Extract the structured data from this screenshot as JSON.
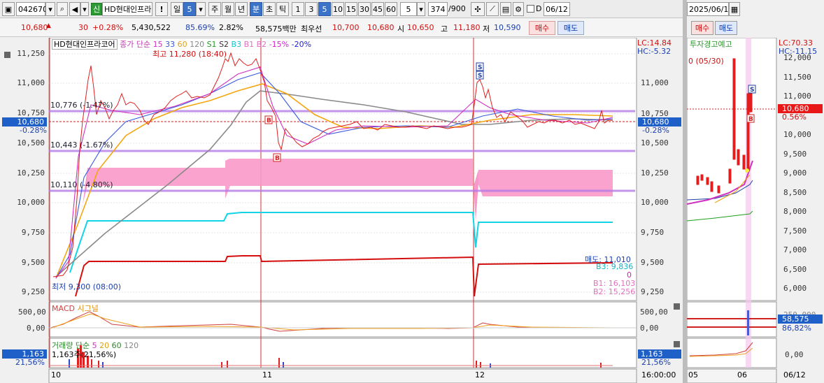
{
  "toolbar": {
    "code": "042670",
    "credit_badge": "신",
    "stock_name": "HD현대인프라",
    "warn": "!",
    "period_label": "일",
    "period_value": "5",
    "periods": [
      "주",
      "월",
      "년",
      "분",
      "초",
      "틱"
    ],
    "intervals": [
      "1",
      "3",
      "5",
      "10",
      "15",
      "30",
      "45",
      "60"
    ],
    "interval_value": "5",
    "count": "374",
    "count_total": "/900",
    "d_label": "D",
    "date": "06/12"
  },
  "quote": {
    "price": "10,680",
    "arrow": "▲",
    "change": "30",
    "pct": "+0.28%",
    "volume": "5,430,522",
    "rate1": "85.69%",
    "rate2": "2.82%",
    "amount": "58,575백만",
    "best_label": "최우선",
    "ask": "10,700",
    "bid": "10,680",
    "open_label": "시",
    "open": "10,650",
    "high_label": "고",
    "high": "11,180",
    "low_label": "저",
    "low": "10,590",
    "buy_btn": "매수",
    "sell_btn": "매도"
  },
  "chart": {
    "legend_name": "HD현대인프라코어",
    "legend_ma_label": "종가 단순",
    "legend_ma": [
      "15",
      "33",
      "60",
      "120"
    ],
    "legend_sigs": [
      "S1",
      "S2",
      "B3",
      "B1",
      "B2"
    ],
    "legend_pcts": [
      "-15%",
      "-20%"
    ],
    "lc": "LC:14.84",
    "hc": "HC:-5.32",
    "max_text": "최고 11,280 (18:40)",
    "min_text": "최저 9,300 (08:00)",
    "line1": "10,776 (-1.47%)",
    "line2": "10,443 (-1.67%)",
    "line3": "10,110 (-4.80%)",
    "cur_price": "10,680",
    "cur_pct": "-0.28%",
    "y_ticks": [
      "11,250",
      "11,000",
      "10,750",
      "10,500",
      "10,250",
      "10,000",
      "9,750",
      "9,500",
      "9,250"
    ],
    "right_labels": [
      "매도: 11,010",
      "B3: 9,836",
      "0",
      "B1: 16,103",
      "B2: 15,256"
    ]
  },
  "macd": {
    "label": "MACD",
    "signal": "시그널",
    "ticks": [
      "500,00",
      "0,00"
    ]
  },
  "volume": {
    "legend_label": "거래량 단순",
    "legend_ma": [
      "5",
      "20",
      "60",
      "120"
    ],
    "val": "1,163",
    "pct": "21,56%",
    "sub": "1,163주(21,56%)"
  },
  "xaxis": {
    "labels": [
      "10",
      "11",
      "12"
    ],
    "end": "16:00:00"
  },
  "right_panel": {
    "date": "2025/06/12",
    "buy_btn": "매수",
    "sell_btn": "매도",
    "warning": "투자경고예고",
    "lc": "LC:70.33",
    "hc": "HC:-11.15",
    "peak_note": "0 (05/30)",
    "cur_price": "10,680",
    "cur_pct": "0.56%",
    "y_ticks": [
      "12,000",
      "11,500",
      "11,000",
      "10,500",
      "10,000",
      "9,500",
      "9,000",
      "8,500",
      "8,000",
      "7,500",
      "7,000",
      "6,500",
      "6,000"
    ],
    "vol_ticks": [
      "250,000",
      "58,575",
      "86,82%"
    ],
    "macd_tick": "0,00",
    "x_labels": [
      "05",
      "06"
    ],
    "x_end": "06/12"
  }
}
